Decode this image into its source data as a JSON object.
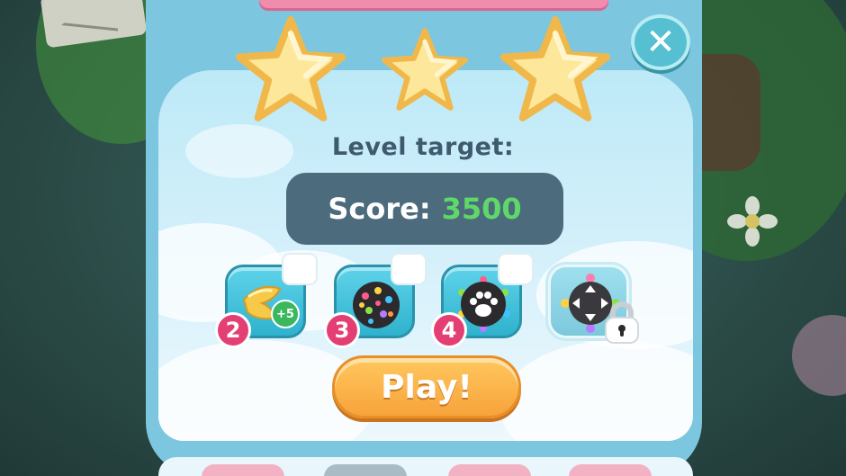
{
  "dialog": {
    "level_target_label": "Level target:",
    "score_label": "Score:",
    "score_value": "3500",
    "play_label": "Play!",
    "close_label": "✕",
    "stars_earned": 3
  },
  "boosters": [
    {
      "name": "golden-hammer",
      "count": "2",
      "bonus_label": "+5",
      "locked": false,
      "selected": false
    },
    {
      "name": "color-candy-bomb",
      "count": "3",
      "locked": false,
      "selected": false
    },
    {
      "name": "paw-candy-bomb",
      "count": "4",
      "locked": false,
      "selected": false
    },
    {
      "name": "arrow-candy-bomb",
      "locked": true
    }
  ],
  "colors": {
    "accent_pink": "#e43f74",
    "score_green": "#5fd86a",
    "play_orange": "#f7a33b",
    "panel_blue": "#7cc6df",
    "star_yellow": "#fde79a"
  }
}
